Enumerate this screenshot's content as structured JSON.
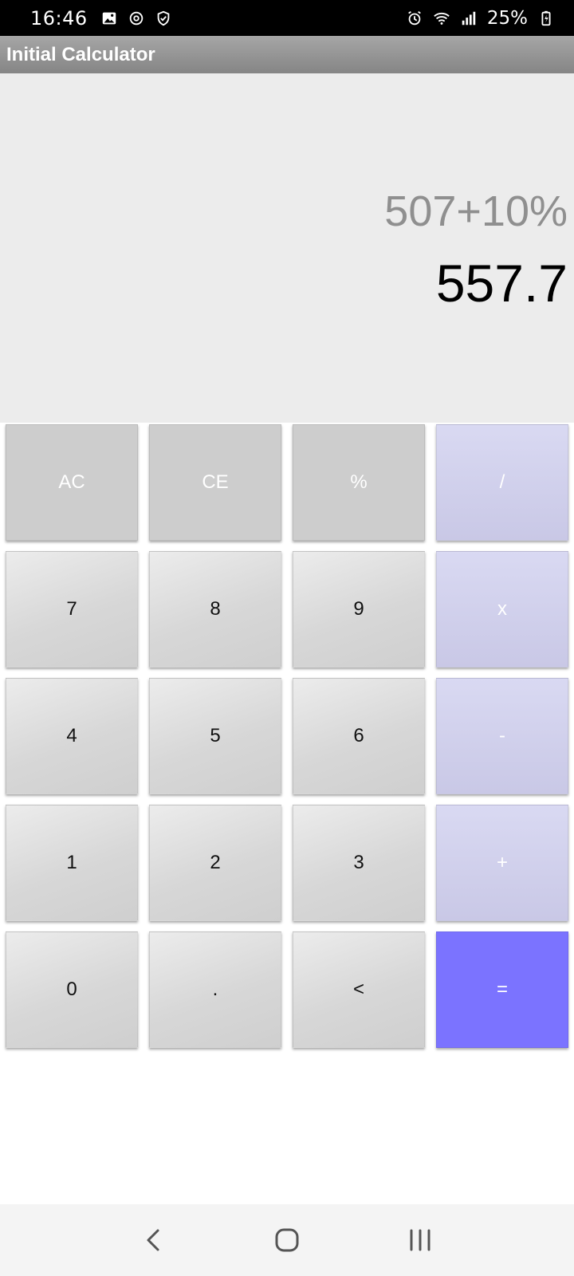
{
  "status_bar": {
    "time": "16:46",
    "battery": "25%",
    "left_icons": [
      "image-icon",
      "sync-icon",
      "shield-icon"
    ],
    "right_icons": [
      "alarm-icon",
      "wifi-icon",
      "signal-icon",
      "battery-charging-icon"
    ]
  },
  "app_bar": {
    "title": "Initial Calculator"
  },
  "display": {
    "expression": "507+10%",
    "result": "557.7"
  },
  "keypad": {
    "keys": [
      {
        "label": "AC",
        "type": "func"
      },
      {
        "label": "CE",
        "type": "func"
      },
      {
        "label": "%",
        "type": "func"
      },
      {
        "label": "/",
        "type": "op"
      },
      {
        "label": "7",
        "type": "num"
      },
      {
        "label": "8",
        "type": "num"
      },
      {
        "label": "9",
        "type": "num"
      },
      {
        "label": "x",
        "type": "op"
      },
      {
        "label": "4",
        "type": "num"
      },
      {
        "label": "5",
        "type": "num"
      },
      {
        "label": "6",
        "type": "num"
      },
      {
        "label": "-",
        "type": "op"
      },
      {
        "label": "1",
        "type": "num"
      },
      {
        "label": "2",
        "type": "num"
      },
      {
        "label": "3",
        "type": "num"
      },
      {
        "label": "+",
        "type": "op"
      },
      {
        "label": "0",
        "type": "num"
      },
      {
        "label": ".",
        "type": "num"
      },
      {
        "label": "<",
        "type": "num"
      },
      {
        "label": "=",
        "type": "eq"
      }
    ]
  },
  "nav_bar": {
    "buttons": [
      "back-icon",
      "home-icon",
      "recents-icon"
    ]
  },
  "colors": {
    "display_bg": "#ececec",
    "expression": "#8f8f8f",
    "result": "#000000",
    "function_key": "#cdcdcd",
    "operator_key": "#d0cfee",
    "equals_key": "#7b73ff"
  }
}
